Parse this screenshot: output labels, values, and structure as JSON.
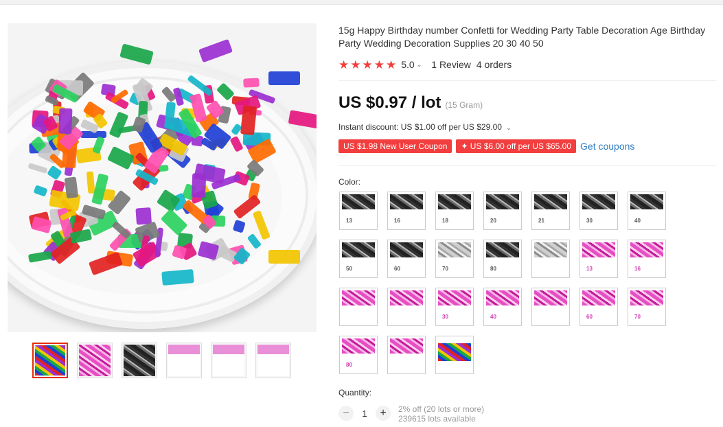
{
  "product": {
    "title": "15g Happy Birthday number Confetti for Wedding Party Table Decoration Age Birthday Party Wedding Decoration Supplies 20 30 40 50",
    "rating_value": "5.0",
    "reviews": "1 Review",
    "orders": "4 orders",
    "price": "US $0.97 / lot",
    "unit": "(15 Gram)",
    "instant_discount": "Instant discount: US $1.00 off per US $29.00",
    "coupons": [
      "US $1.98 New User Coupon",
      "✦ US $6.00 off per US $65.00"
    ],
    "get_coupons": "Get coupons",
    "color_label": "Color:",
    "quantity_label": "Quantity:",
    "quantity_value": "1",
    "quantity_discount": "2% off (20 lots or more)",
    "available": "239615 lots available"
  },
  "rating": {
    "stars": 5
  },
  "colors": {
    "accent_red": "#f23e3e",
    "link_blue": "#2f7dc2",
    "selected_border": "#e62e04"
  },
  "thumbnails": [
    "multicolor",
    "pink",
    "silver",
    "pink-13",
    "pink-16",
    "pink-mixed"
  ],
  "color_options": [
    {
      "tone": "black",
      "num": "13"
    },
    {
      "tone": "black",
      "num": "16"
    },
    {
      "tone": "black",
      "num": "18"
    },
    {
      "tone": "black",
      "num": "20"
    },
    {
      "tone": "black",
      "num": "21"
    },
    {
      "tone": "black",
      "num": "30"
    },
    {
      "tone": "black",
      "num": "40"
    },
    {
      "tone": "black",
      "num": "50"
    },
    {
      "tone": "black",
      "num": "60"
    },
    {
      "tone": "silver",
      "num": "70"
    },
    {
      "tone": "black",
      "num": "80"
    },
    {
      "tone": "silver",
      "num": ""
    },
    {
      "tone": "pink",
      "num": "13"
    },
    {
      "tone": "pink",
      "num": "16"
    },
    {
      "tone": "pink",
      "num": ""
    },
    {
      "tone": "pink",
      "num": ""
    },
    {
      "tone": "pink",
      "num": "30"
    },
    {
      "tone": "pink",
      "num": "40"
    },
    {
      "tone": "pink",
      "num": ""
    },
    {
      "tone": "pink",
      "num": "60"
    },
    {
      "tone": "pink",
      "num": "70"
    },
    {
      "tone": "pink",
      "num": "80"
    },
    {
      "tone": "pink",
      "num": ""
    },
    {
      "tone": "multicolor",
      "num": ""
    }
  ]
}
